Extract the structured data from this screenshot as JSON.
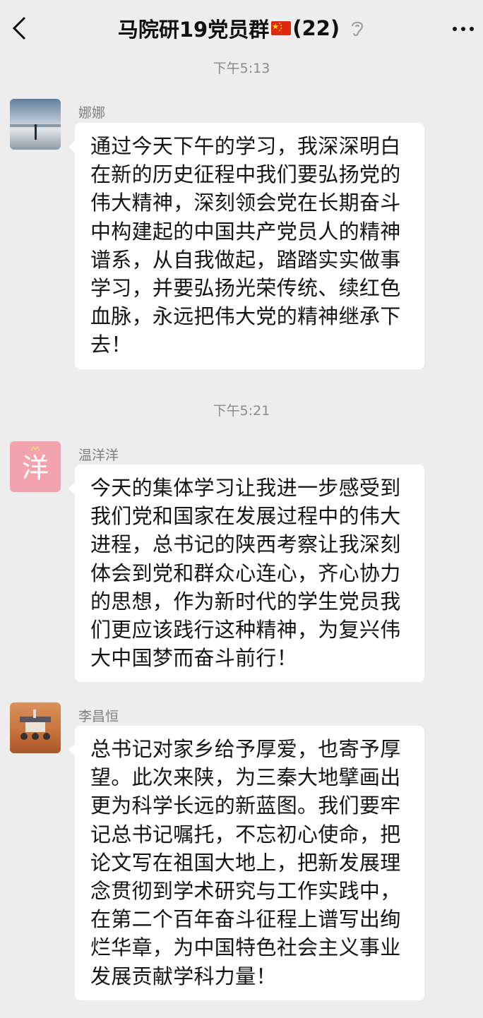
{
  "header": {
    "title": "马院研19党员群",
    "count": "(22)",
    "back_icon": "chevron-left-icon",
    "mute_icon": "ear-muted-icon",
    "more_icon": "more-dots-icon",
    "flag_icon": "china-flag-icon"
  },
  "messages": [
    {
      "time": "下午5:13",
      "sender": "娜娜",
      "lines": [
        "通过今天下午的学习，我深深明白",
        "在新的历史征程中我们要弘扬党的",
        "伟大精神，深刻领会党在长期奋斗",
        "中构建起的中国共产党员人的精神",
        "谱系，从自我做起，踏踏实实做事",
        "学习，并要弘扬光荣传统、续红色",
        "血脉，永远把伟大党的精神继承下",
        "去！"
      ]
    },
    {
      "time": "下午5:21",
      "sender": "温洋洋",
      "avatar_text": "洋",
      "lines": [
        "今天的集体学习让我进一步感受到",
        "我们党和国家在发展过程中的伟大",
        "进程，总书记的陕西考察让我深刻",
        "体会到党和群众心连心，齐心协力",
        "的思想，作为新时代的学生党员我",
        "们更应该践行这种精神，为复兴伟",
        "大中国梦而奋斗前行！"
      ]
    },
    {
      "sender": "李昌恒",
      "lines": [
        "总书记对家乡给予厚爱，也寄予厚",
        "望。此次来陕，为三秦大地擘画出",
        "更为科学长远的新蓝图。我们要牢",
        "记总书记嘱托，不忘初心使命，把",
        "论文写在祖国大地上，把新发展理",
        "念贯彻到学术研究与工作实践中，",
        "在第二个百年奋斗征程上谱写出绚",
        "烂华章，为中国特色社会主义事业",
        "发展贡献学科力量！"
      ]
    }
  ],
  "colors": {
    "background": "#ededed",
    "bubble": "#ffffff",
    "avatar_pink": "#f2a3ad"
  }
}
